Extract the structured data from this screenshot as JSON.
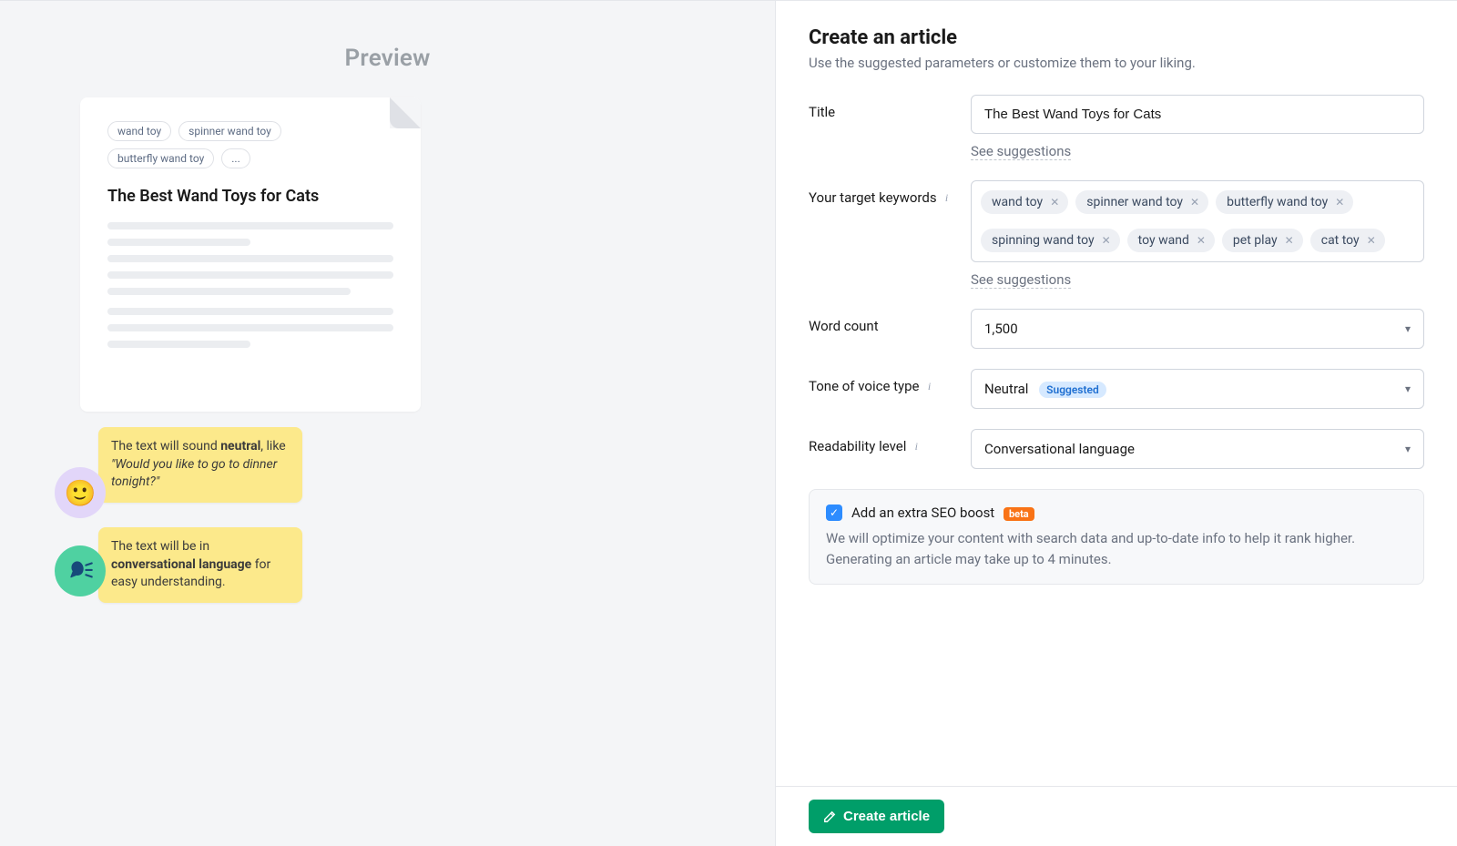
{
  "preview": {
    "heading": "Preview",
    "doc_title": "The Best Wand Toys for Cats",
    "tags": [
      "wand toy",
      "spinner wand toy",
      "butterfly wand toy",
      "..."
    ],
    "bubble1_pre": "The text will sound ",
    "bubble1_bold": "neutral",
    "bubble1_mid": ", like ",
    "bubble1_quote": "\"Would you like to go to dinner tonight?\"",
    "bubble2_pre": "The text will be in ",
    "bubble2_bold": "conversational language",
    "bubble2_post": " for easy understanding."
  },
  "form": {
    "title": "Create an article",
    "subtitle": "Use the suggested parameters or customize them to your liking.",
    "labels": {
      "title": "Title",
      "keywords": "Your target keywords",
      "wordcount": "Word count",
      "tone": "Tone of voice type",
      "readability": "Readability level"
    },
    "title_value": "The Best Wand Toys for Cats",
    "see_suggestions": "See suggestions",
    "keywords": [
      "wand toy",
      "spinner wand toy",
      "butterfly wand toy",
      "spinning wand toy",
      "toy wand",
      "pet play",
      "cat toy"
    ],
    "wordcount_value": "1,500",
    "tone_value": "Neutral",
    "tone_badge": "Suggested",
    "readability_value": "Conversational language",
    "seo": {
      "label": "Add an extra SEO boost",
      "beta": "beta",
      "desc": "We will optimize your content with search data and up-to-date info to help it rank higher. Generating an article may take up to 4 minutes."
    },
    "create_button": "Create article"
  }
}
